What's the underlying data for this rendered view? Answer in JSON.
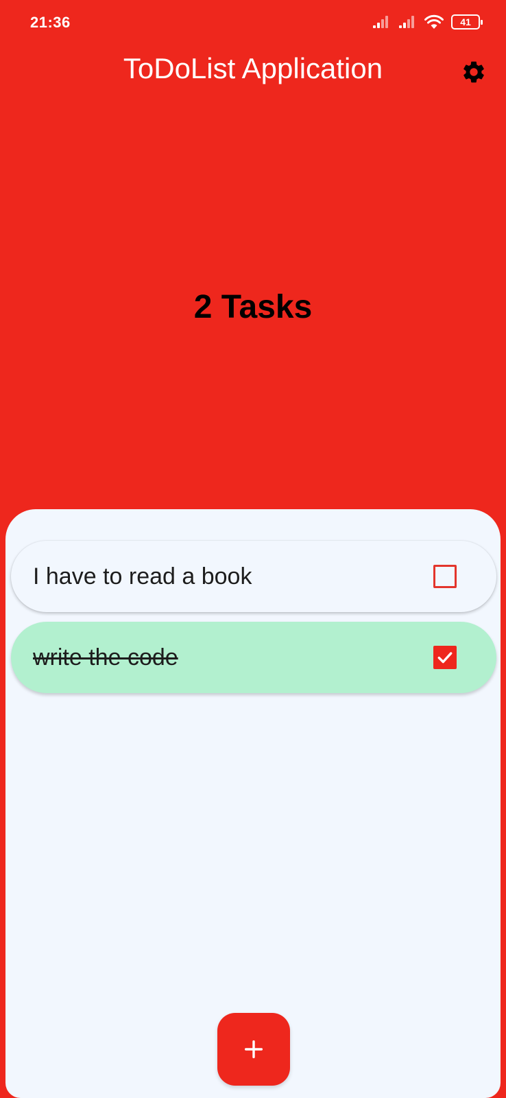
{
  "status_bar": {
    "time": "21:36",
    "battery": "41"
  },
  "app_bar": {
    "title": "ToDoList Application",
    "settings_icon": "gear-icon"
  },
  "summary": {
    "task_count_label": "2 Tasks"
  },
  "tasks": [
    {
      "text": "I have to read a book",
      "done": false
    },
    {
      "text": "write the code",
      "done": true
    }
  ],
  "fab": {
    "icon": "plus-icon"
  },
  "colors": {
    "primary": "#EE271D",
    "sheet_bg": "#F2F7FE",
    "done_bg": "#B2F0CF"
  }
}
